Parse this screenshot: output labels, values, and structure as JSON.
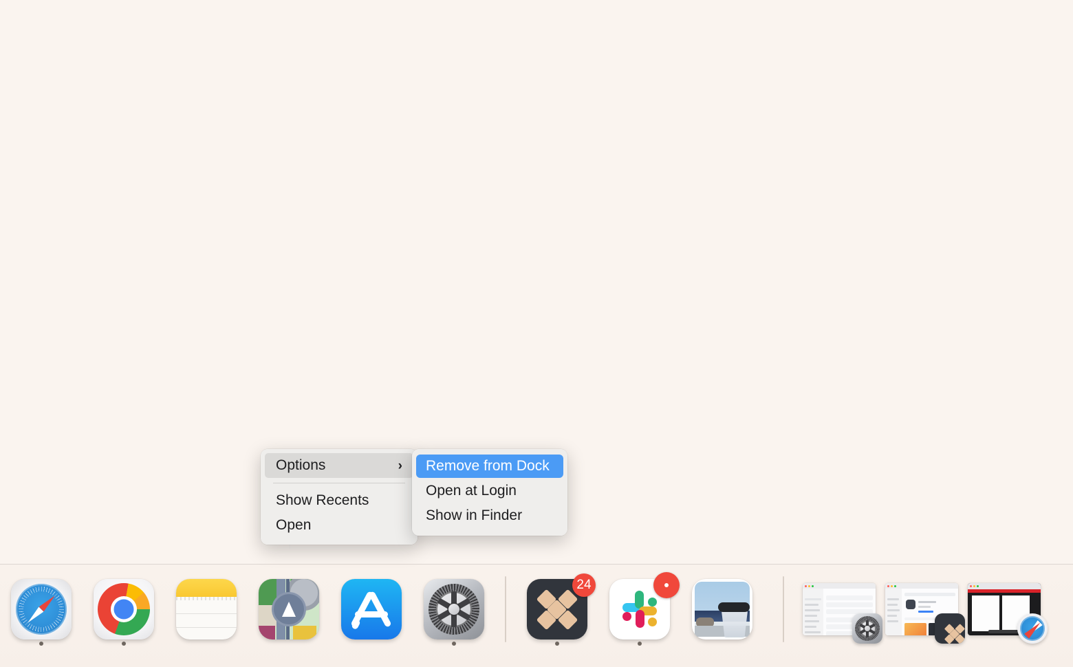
{
  "desktop": {
    "background_color": "#faf4ef"
  },
  "context_menu": {
    "items": [
      {
        "label": "Options",
        "has_submenu": true,
        "highlighted": true,
        "chevron": "›"
      },
      {
        "label": "Show Recents",
        "has_submenu": false,
        "highlighted": false
      },
      {
        "label": "Open",
        "has_submenu": false,
        "highlighted": false
      }
    ]
  },
  "submenu": {
    "items": [
      {
        "label": "Remove from Dock",
        "highlighted": true
      },
      {
        "label": "Open at Login",
        "highlighted": false
      },
      {
        "label": "Show in Finder",
        "highlighted": false
      }
    ],
    "highlight_color": "#4b9bf5"
  },
  "dock": {
    "background_color": "#f8f1eb",
    "separator_color": "#c9b9ac",
    "running_indicator_color": "#6f6760",
    "badge_color": "#f0483b",
    "apps": [
      {
        "name": "Safari",
        "icon": "safari-icon",
        "running": true,
        "badge": null
      },
      {
        "name": "Google Chrome",
        "icon": "chrome-icon",
        "running": true,
        "badge": null
      },
      {
        "name": "Notes",
        "icon": "notes-icon",
        "running": false,
        "badge": null
      },
      {
        "name": "Maps",
        "icon": "maps-icon",
        "running": false,
        "badge": null
      },
      {
        "name": "App Store",
        "icon": "app-store-icon",
        "running": false,
        "badge": null
      },
      {
        "name": "System Settings",
        "icon": "system-settings-icon",
        "running": true,
        "badge": null
      }
    ],
    "recent_apps": [
      {
        "name": "Dropbox",
        "icon": "dropbox-icon",
        "running": true,
        "badge": "24",
        "badge_type": "count"
      },
      {
        "name": "Slack",
        "icon": "slack-icon",
        "running": true,
        "badge": "•",
        "badge_type": "dot"
      },
      {
        "name": "Preview",
        "icon": "preview-icon",
        "running": false,
        "badge": null
      }
    ],
    "minimized_windows": [
      {
        "name": "System Settings window",
        "app_badge": "system-settings-icon"
      },
      {
        "name": "App Store – Dropbox window",
        "app_badge": "dropbox-icon"
      },
      {
        "name": "Safari – PDF window",
        "app_badge": "safari-icon"
      }
    ]
  }
}
